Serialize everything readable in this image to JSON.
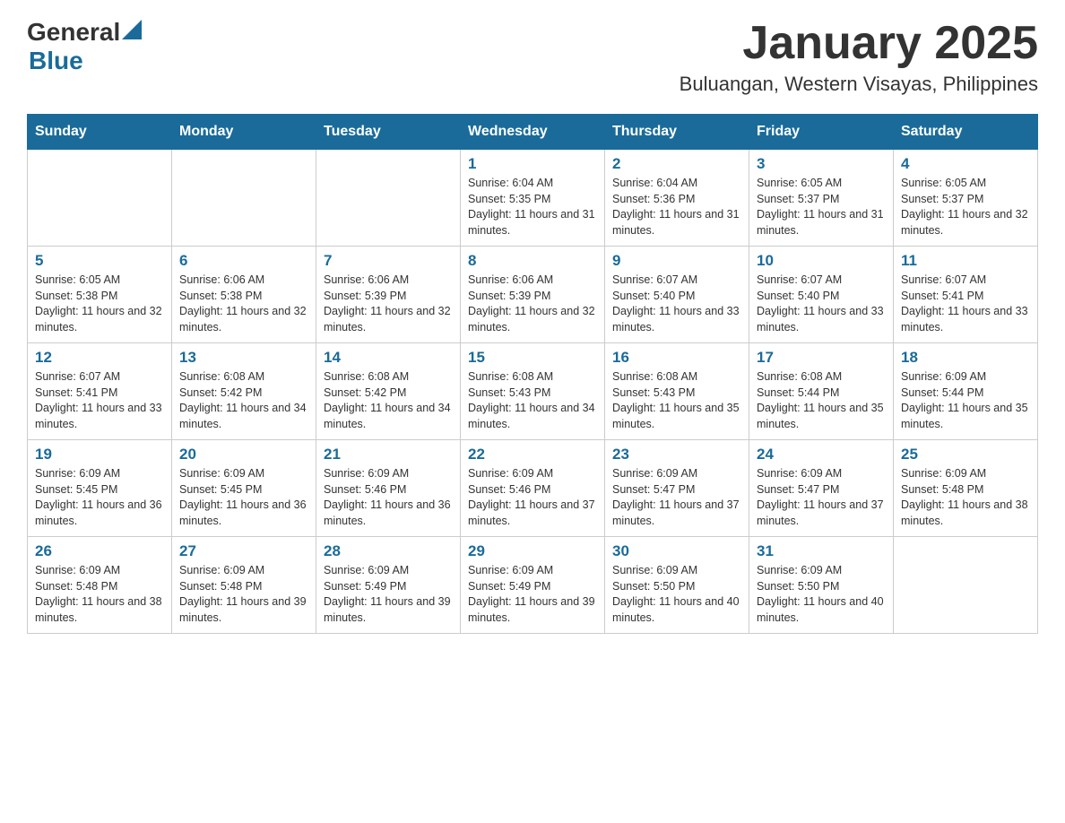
{
  "logo": {
    "text_general": "General",
    "text_blue": "Blue"
  },
  "title": "January 2025",
  "subtitle": "Buluangan, Western Visayas, Philippines",
  "days_of_week": [
    "Sunday",
    "Monday",
    "Tuesday",
    "Wednesday",
    "Thursday",
    "Friday",
    "Saturday"
  ],
  "weeks": [
    [
      {
        "day": "",
        "info": ""
      },
      {
        "day": "",
        "info": ""
      },
      {
        "day": "",
        "info": ""
      },
      {
        "day": "1",
        "info": "Sunrise: 6:04 AM\nSunset: 5:35 PM\nDaylight: 11 hours and 31 minutes."
      },
      {
        "day": "2",
        "info": "Sunrise: 6:04 AM\nSunset: 5:36 PM\nDaylight: 11 hours and 31 minutes."
      },
      {
        "day": "3",
        "info": "Sunrise: 6:05 AM\nSunset: 5:37 PM\nDaylight: 11 hours and 31 minutes."
      },
      {
        "day": "4",
        "info": "Sunrise: 6:05 AM\nSunset: 5:37 PM\nDaylight: 11 hours and 32 minutes."
      }
    ],
    [
      {
        "day": "5",
        "info": "Sunrise: 6:05 AM\nSunset: 5:38 PM\nDaylight: 11 hours and 32 minutes."
      },
      {
        "day": "6",
        "info": "Sunrise: 6:06 AM\nSunset: 5:38 PM\nDaylight: 11 hours and 32 minutes."
      },
      {
        "day": "7",
        "info": "Sunrise: 6:06 AM\nSunset: 5:39 PM\nDaylight: 11 hours and 32 minutes."
      },
      {
        "day": "8",
        "info": "Sunrise: 6:06 AM\nSunset: 5:39 PM\nDaylight: 11 hours and 32 minutes."
      },
      {
        "day": "9",
        "info": "Sunrise: 6:07 AM\nSunset: 5:40 PM\nDaylight: 11 hours and 33 minutes."
      },
      {
        "day": "10",
        "info": "Sunrise: 6:07 AM\nSunset: 5:40 PM\nDaylight: 11 hours and 33 minutes."
      },
      {
        "day": "11",
        "info": "Sunrise: 6:07 AM\nSunset: 5:41 PM\nDaylight: 11 hours and 33 minutes."
      }
    ],
    [
      {
        "day": "12",
        "info": "Sunrise: 6:07 AM\nSunset: 5:41 PM\nDaylight: 11 hours and 33 minutes."
      },
      {
        "day": "13",
        "info": "Sunrise: 6:08 AM\nSunset: 5:42 PM\nDaylight: 11 hours and 34 minutes."
      },
      {
        "day": "14",
        "info": "Sunrise: 6:08 AM\nSunset: 5:42 PM\nDaylight: 11 hours and 34 minutes."
      },
      {
        "day": "15",
        "info": "Sunrise: 6:08 AM\nSunset: 5:43 PM\nDaylight: 11 hours and 34 minutes."
      },
      {
        "day": "16",
        "info": "Sunrise: 6:08 AM\nSunset: 5:43 PM\nDaylight: 11 hours and 35 minutes."
      },
      {
        "day": "17",
        "info": "Sunrise: 6:08 AM\nSunset: 5:44 PM\nDaylight: 11 hours and 35 minutes."
      },
      {
        "day": "18",
        "info": "Sunrise: 6:09 AM\nSunset: 5:44 PM\nDaylight: 11 hours and 35 minutes."
      }
    ],
    [
      {
        "day": "19",
        "info": "Sunrise: 6:09 AM\nSunset: 5:45 PM\nDaylight: 11 hours and 36 minutes."
      },
      {
        "day": "20",
        "info": "Sunrise: 6:09 AM\nSunset: 5:45 PM\nDaylight: 11 hours and 36 minutes."
      },
      {
        "day": "21",
        "info": "Sunrise: 6:09 AM\nSunset: 5:46 PM\nDaylight: 11 hours and 36 minutes."
      },
      {
        "day": "22",
        "info": "Sunrise: 6:09 AM\nSunset: 5:46 PM\nDaylight: 11 hours and 37 minutes."
      },
      {
        "day": "23",
        "info": "Sunrise: 6:09 AM\nSunset: 5:47 PM\nDaylight: 11 hours and 37 minutes."
      },
      {
        "day": "24",
        "info": "Sunrise: 6:09 AM\nSunset: 5:47 PM\nDaylight: 11 hours and 37 minutes."
      },
      {
        "day": "25",
        "info": "Sunrise: 6:09 AM\nSunset: 5:48 PM\nDaylight: 11 hours and 38 minutes."
      }
    ],
    [
      {
        "day": "26",
        "info": "Sunrise: 6:09 AM\nSunset: 5:48 PM\nDaylight: 11 hours and 38 minutes."
      },
      {
        "day": "27",
        "info": "Sunrise: 6:09 AM\nSunset: 5:48 PM\nDaylight: 11 hours and 39 minutes."
      },
      {
        "day": "28",
        "info": "Sunrise: 6:09 AM\nSunset: 5:49 PM\nDaylight: 11 hours and 39 minutes."
      },
      {
        "day": "29",
        "info": "Sunrise: 6:09 AM\nSunset: 5:49 PM\nDaylight: 11 hours and 39 minutes."
      },
      {
        "day": "30",
        "info": "Sunrise: 6:09 AM\nSunset: 5:50 PM\nDaylight: 11 hours and 40 minutes."
      },
      {
        "day": "31",
        "info": "Sunrise: 6:09 AM\nSunset: 5:50 PM\nDaylight: 11 hours and 40 minutes."
      },
      {
        "day": "",
        "info": ""
      }
    ]
  ]
}
